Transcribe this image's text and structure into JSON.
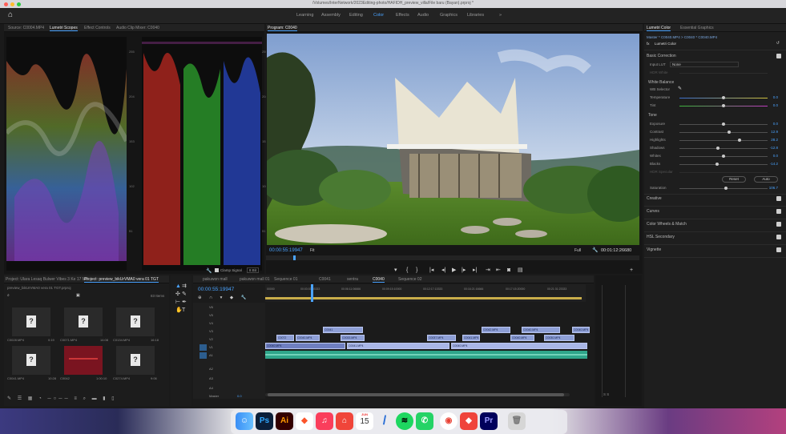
{
  "window": {
    "title": "/Volumes/InterNetwork/2023Editing-photo/HAFIDH_preview_villa/File baru (Bayan).prproj *"
  },
  "appbar": {
    "workspaces": [
      {
        "label": "Learning",
        "active": false
      },
      {
        "label": "Assembly",
        "active": false
      },
      {
        "label": "Editing",
        "active": false
      },
      {
        "label": "Color",
        "active": true
      },
      {
        "label": "Effects",
        "active": false
      },
      {
        "label": "Audio",
        "active": false
      },
      {
        "label": "Graphics",
        "active": false
      },
      {
        "label": "Libraries",
        "active": false
      }
    ],
    "more": "»"
  },
  "scopes": {
    "tabs": [
      {
        "label": "Source: C0004.MP4",
        "active": false
      },
      {
        "label": "Lumetri Scopes",
        "active": true
      },
      {
        "label": "Effect Controls",
        "active": false
      },
      {
        "label": "Audio Clip Mixer: C0040",
        "active": false
      }
    ],
    "scale_left": [
      "255",
      "204",
      "153",
      "102",
      "51"
    ],
    "scale_mid": [
      "255",
      "204",
      "153",
      "102",
      "51"
    ],
    "footer_signal": "Clamp Signal",
    "footer_bits": "8 Bit"
  },
  "program": {
    "tab": "Program: C0040",
    "timecode": "00:00:55:19947",
    "fit": "Fit",
    "full": "Full",
    "duration": "00:01:12:26680"
  },
  "lumetri": {
    "tabs": [
      {
        "label": "Lumetri Color",
        "active": true
      },
      {
        "label": "Essential Graphics",
        "active": false
      }
    ],
    "source_line": "Master * C0040.MP4  >  C0040 * C0040.MP4",
    "fx_label": "fx",
    "effect_name": "Lumetri Color",
    "basic_correction": "Basic Correction",
    "input_lut_label": "Input LUT",
    "input_lut_value": "None",
    "hdr_white": "HDR White",
    "white_balance": "White Balance",
    "wb_selector": "WB Selector",
    "temperature": {
      "label": "Temperature",
      "value": "0.0",
      "pos": 0.5
    },
    "tint": {
      "label": "Tint",
      "value": "0.0",
      "pos": 0.5
    },
    "tone": "Tone",
    "exposure": {
      "label": "Exposure",
      "value": "0.0",
      "pos": 0.5
    },
    "contrast": {
      "label": "Contrast",
      "value": "12.9",
      "pos": 0.56
    },
    "highlights": {
      "label": "Highlights",
      "value": "28.2",
      "pos": 0.68
    },
    "shadows": {
      "label": "Shadows",
      "value": "-12.8",
      "pos": 0.44
    },
    "whites": {
      "label": "Whites",
      "value": "0.0",
      "pos": 0.5
    },
    "blacks": {
      "label": "Blacks",
      "value": "-14.2",
      "pos": 0.43
    },
    "hdr_specular": "HDR Specular",
    "reset": "Reset",
    "auto": "Auto",
    "saturation": {
      "label": "Saturation",
      "value": "106.7",
      "pos": 0.53
    },
    "sections": [
      "Creative",
      "Curves",
      "Color Wheels & Match",
      "HSL Secondary",
      "Vignette"
    ]
  },
  "project": {
    "tabs": [
      {
        "label": "Project: Ulara Lesaq Bulwer Vibes 3 Ke 17 MB",
        "active": false
      },
      {
        "label": "Project: preview_bikUrVMA0 vera 01 TGT",
        "active": true
      }
    ],
    "path": "preview_bikUrVMA0 vera 01 TGT.prproj",
    "item_count": "83 Items",
    "clips": [
      {
        "name": "C0028.MP4",
        "dur": "0:19"
      },
      {
        "name": "C0071.MP4",
        "dur": "14:08"
      },
      {
        "name": "C0134.MP4",
        "dur": "16:18"
      },
      {
        "name": "C0041.MP4",
        "dur": "10:28"
      },
      {
        "name": "C0042",
        "dur": "1:00:10"
      },
      {
        "name": "C0274.MP4",
        "dur": "9:06"
      }
    ]
  },
  "timeline": {
    "tabs": [
      {
        "label": "pakuwon mall",
        "active": false
      },
      {
        "label": "pakuwon mall 01",
        "active": false
      },
      {
        "label": "Sequence 01",
        "active": false
      },
      {
        "label": "C0041",
        "active": false
      },
      {
        "label": "sentra",
        "active": false
      },
      {
        "label": "C0040",
        "active": true
      },
      {
        "label": "Sequence 02",
        "active": false
      }
    ],
    "timecode": "00:00:55:19947",
    "ruler": [
      "00000",
      "00:03:03:03333",
      "00:06:11:06666",
      "00:09:15:10000",
      "00:12:17:13333",
      "00:16:21:16666",
      "00:17:15:20000",
      "00:21:31:23333",
      "00:25:09:26666"
    ],
    "tracks": [
      "V6",
      "V5",
      "V4",
      "V3",
      "V2",
      "V1",
      "A1",
      "A2",
      "A3",
      "A4"
    ],
    "master": "Master",
    "master_value": "0.0",
    "clips_v3": [
      "C0041",
      "C0042.MP4",
      "C0040.MP4",
      "C0040.MP4"
    ],
    "clips_v2": [
      "C0072",
      "C0040.MP4",
      "C0033.MP4",
      "C0037.MP4",
      "C0041.MP4",
      "C0040.MP4",
      "C0030.MP4"
    ],
    "clips_v1": [
      "C0040.MP4",
      "C0041.MP4",
      "C0040.MP4"
    ]
  },
  "dock": {
    "apps": [
      "finder-icon",
      "photoshop-icon",
      "illustrator-icon",
      "brave-icon",
      "music-icon",
      "app-store-icon",
      "calendar-icon",
      "notes-icon",
      "spotify-icon",
      "whatsapp-icon",
      "chrome-icon",
      "anydesk-icon",
      "premiere-icon",
      "trash-icon"
    ],
    "calendar_month": "JUN",
    "calendar_day": "15"
  }
}
